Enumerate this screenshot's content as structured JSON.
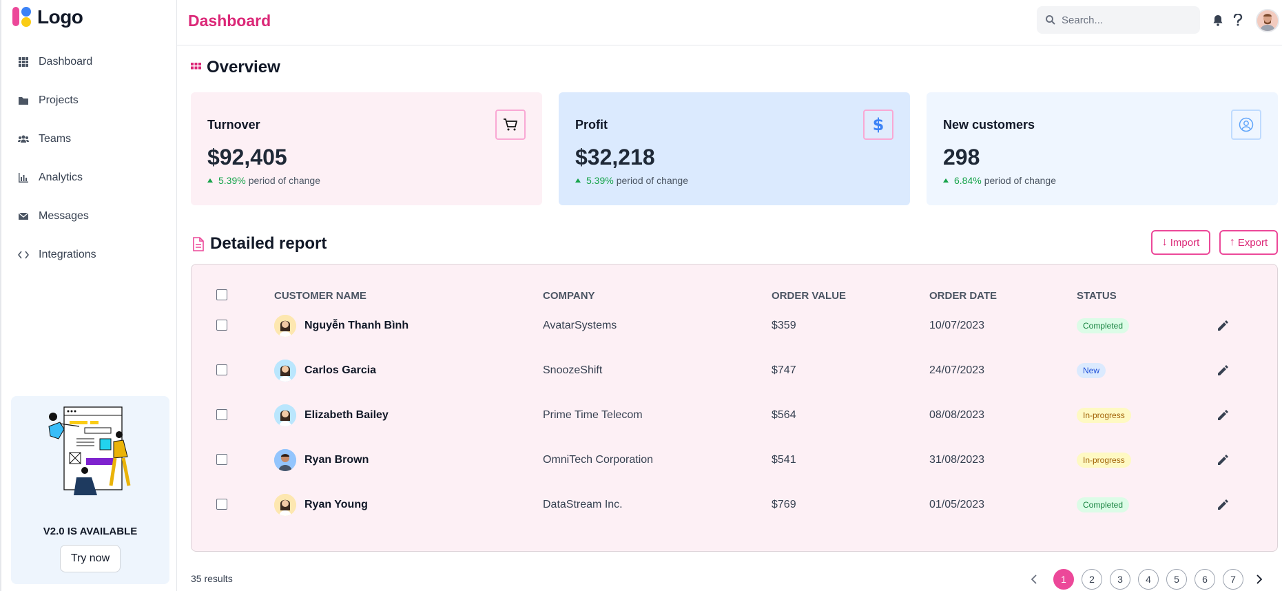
{
  "brand": {
    "logo_text": "Logo",
    "accent": "#db2777",
    "pink": "#ec4899"
  },
  "sidebar": {
    "items": [
      {
        "label": "Dashboard",
        "icon": "grid-icon"
      },
      {
        "label": "Projects",
        "icon": "folder-icon"
      },
      {
        "label": "Teams",
        "icon": "users-icon"
      },
      {
        "label": "Analytics",
        "icon": "chart-bar-icon"
      },
      {
        "label": "Messages",
        "icon": "envelope-icon"
      },
      {
        "label": "Integrations",
        "icon": "code-icon"
      }
    ],
    "promo": {
      "title": "V2.0 IS AVAILABLE",
      "button": "Try now"
    }
  },
  "header": {
    "title": "Dashboard",
    "search_placeholder": "Search..."
  },
  "overview": {
    "title": "Overview",
    "cards": [
      {
        "title": "Turnover",
        "value": "$92,405",
        "change": "5.39%",
        "change_label": "period of change",
        "icon": "cart-icon",
        "bg": "#fdf0f5"
      },
      {
        "title": "Profit",
        "value": "$32,218",
        "change": "5.39%",
        "change_label": "period of change",
        "icon": "dollar-icon",
        "bg": "#dbeafe"
      },
      {
        "title": "New customers",
        "value": "298",
        "change": "6.84%",
        "change_label": "period of change",
        "icon": "user-circle-icon",
        "bg": "#eff6ff"
      }
    ]
  },
  "report": {
    "title": "Detailed report",
    "import_label": "Import",
    "export_label": "Export",
    "columns": [
      "CUSTOMER NAME",
      "COMPANY",
      "ORDER VALUE",
      "ORDER DATE",
      "STATUS"
    ],
    "rows": [
      {
        "name": "Nguyễn Thanh Bình",
        "company": "AvatarSystems",
        "value": "$359",
        "date": "10/07/2023",
        "status": "Completed"
      },
      {
        "name": "Carlos Garcia",
        "company": "SnoozeShift",
        "value": "$747",
        "date": "24/07/2023",
        "status": "New"
      },
      {
        "name": "Elizabeth Bailey",
        "company": "Prime Time Telecom",
        "value": "$564",
        "date": "08/08/2023",
        "status": "In-progress"
      },
      {
        "name": "Ryan Brown",
        "company": "OmniTech Corporation",
        "value": "$541",
        "date": "31/08/2023",
        "status": "In-progress"
      },
      {
        "name": "Ryan Young",
        "company": "DataStream Inc.",
        "value": "$769",
        "date": "01/05/2023",
        "status": "Completed"
      }
    ],
    "results": "35 results",
    "pages": [
      "1",
      "2",
      "3",
      "4",
      "5",
      "6",
      "7"
    ],
    "current_page": "1"
  },
  "status_colors": {
    "Completed": {
      "bg": "#dcfce7",
      "fg": "#15803d"
    },
    "New": {
      "bg": "#dbeafe",
      "fg": "#1d4ed8"
    },
    "In-progress": {
      "bg": "#fef9c3",
      "fg": "#a16207"
    }
  }
}
